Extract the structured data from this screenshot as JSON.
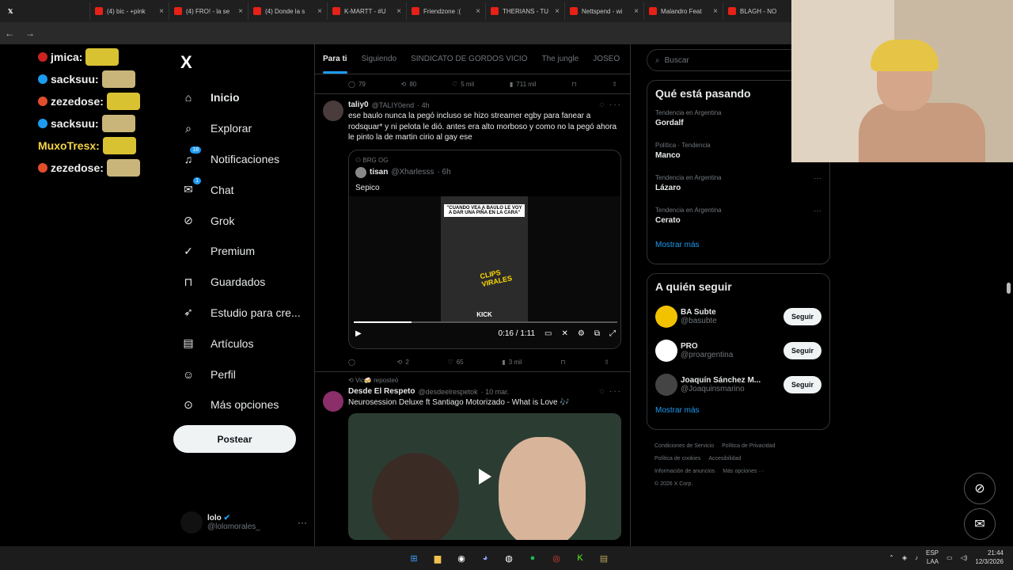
{
  "browser": {
    "tabs": [
      {
        "label": "(4) bic - +pink"
      },
      {
        "label": "(4) FRO! - la se"
      },
      {
        "label": "(4) Donde la s"
      },
      {
        "label": "K-MARTT - #U"
      },
      {
        "label": "Friendzone :("
      },
      {
        "label": "THERIANS - TU"
      },
      {
        "label": "Nettspend - wi"
      },
      {
        "label": "Malandro Feat"
      },
      {
        "label": "BLAGH - NO"
      }
    ]
  },
  "chat_overlay": {
    "lines": [
      {
        "user": "jmica:",
        "color": "#f0f0f0",
        "badge": "#cc2222"
      },
      {
        "user": "sacksuu:",
        "color": "#f0f0f0",
        "badge": "#1d9bf0"
      },
      {
        "user": "zezedose:",
        "color": "#f0f0f0",
        "badge": "#e24d2c"
      },
      {
        "user": "sacksuu:",
        "color": "#f0f0f0",
        "badge": "#1d9bf0"
      },
      {
        "user": "MuxoTresx:",
        "color": "#f5d44a",
        "badge": ""
      },
      {
        "user": "zezedose:",
        "color": "#f0f0f0",
        "badge": "#e24d2c"
      }
    ]
  },
  "nav": {
    "logo": "X",
    "items": [
      {
        "label": "Inicio",
        "icon": "home-icon",
        "badge": ""
      },
      {
        "label": "Explorar",
        "icon": "search-icon",
        "badge": ""
      },
      {
        "label": "Notificaciones",
        "icon": "bell-icon",
        "badge": "18"
      },
      {
        "label": "Chat",
        "icon": "mail-icon",
        "badge": "1"
      },
      {
        "label": "Grok",
        "icon": "grok-icon",
        "badge": ""
      },
      {
        "label": "Premium",
        "icon": "premium-icon",
        "badge": ""
      },
      {
        "label": "Guardados",
        "icon": "bookmark-icon",
        "badge": ""
      },
      {
        "label": "Estudio para cre...",
        "icon": "rocket-icon",
        "badge": ""
      },
      {
        "label": "Artículos",
        "icon": "article-icon",
        "badge": ""
      },
      {
        "label": "Perfil",
        "icon": "user-icon",
        "badge": ""
      },
      {
        "label": "Más opciones",
        "icon": "more-icon",
        "badge": ""
      }
    ],
    "post_label": "Postear",
    "profile": {
      "name": "lolo",
      "handle": "@lolomorales_"
    }
  },
  "timeline": {
    "tabs": [
      "Para ti",
      "Siguiendo",
      "SINDICATO DE GORDOS VICIO",
      "The jungle",
      "JOSEO"
    ],
    "prev_actions": {
      "replies": "79",
      "reposts": "80",
      "likes": "5 mil",
      "views": "711 mil"
    },
    "post1": {
      "name": "taliy0",
      "handle": "@TALIY0end",
      "time": "· 4h",
      "text": "ese baulo nunca la pegó incluso se hizo streamer egby para fanear a rodsquar* y ni pelota le dió. antes era alto morboso y como no la pegó ahora le pinto la de martin cirio al gay ese",
      "quote": {
        "context": "BRG OG",
        "name": "tisan",
        "handle": "@Xharlesss",
        "time": "· 6h",
        "text": "Sepico",
        "video_caption": "\"CUANDO VEA A BAULO LE VOY A DAR UNA PIÑA EN LA CARA\"",
        "video_brand": "KICK",
        "watermark": "CLIPS VIRALES",
        "progress": 0.22,
        "time_display": "0:16 / 1:11"
      },
      "actions": {
        "replies": "",
        "reposts": "2",
        "likes": "65",
        "views": "3 mil"
      }
    },
    "post2": {
      "repost_by": "Vic🍻 reposteó",
      "name": "Desde El Respeto",
      "handle": "@desdeelrespetok",
      "time": "· 10 mar.",
      "text": "Neurosession Deluxe ft Santiago Motorizado - What is Love 🎶"
    }
  },
  "right": {
    "search_placeholder": "Buscar",
    "trends_title": "Qué está pasando",
    "trends": [
      {
        "meta": "Tendencia en Argentina",
        "name": "Gordalf"
      },
      {
        "meta": "Política · Tendencia",
        "name": "Manco"
      },
      {
        "meta": "Tendencia en Argentina",
        "name": "Lázaro"
      },
      {
        "meta": "Tendencia en Argentina",
        "name": "Cerato"
      }
    ],
    "trends_more": "Mostrar más",
    "follow_title": "A quién seguir",
    "follow": [
      {
        "name": "BA Subte",
        "handle": "@basubte",
        "button": "Seguir",
        "avatar_color": "#f2c200"
      },
      {
        "name": "PRO",
        "handle": "@proargentina",
        "button": "Seguir",
        "avatar_color": "#ffffff"
      },
      {
        "name": "Joaquín Sánchez M...",
        "handle": "@Joaquinsmarino",
        "button": "Seguir",
        "avatar_color": "#444444"
      }
    ],
    "follow_more": "Mostrar más",
    "footer": [
      "Condiciones de Servicio",
      "Política de Privacidad",
      "Política de cookies",
      "Accesibilidad",
      "Información de anuncios",
      "Más opciones ···",
      "© 2026 X Corp."
    ]
  },
  "taskbar": {
    "lang1": "ESP",
    "lang2": "LAA",
    "time": "21:44",
    "date": "12/3/2026"
  },
  "colors": {
    "accent": "#1d9bf0",
    "bg": "#000000",
    "border": "#2f3336"
  }
}
